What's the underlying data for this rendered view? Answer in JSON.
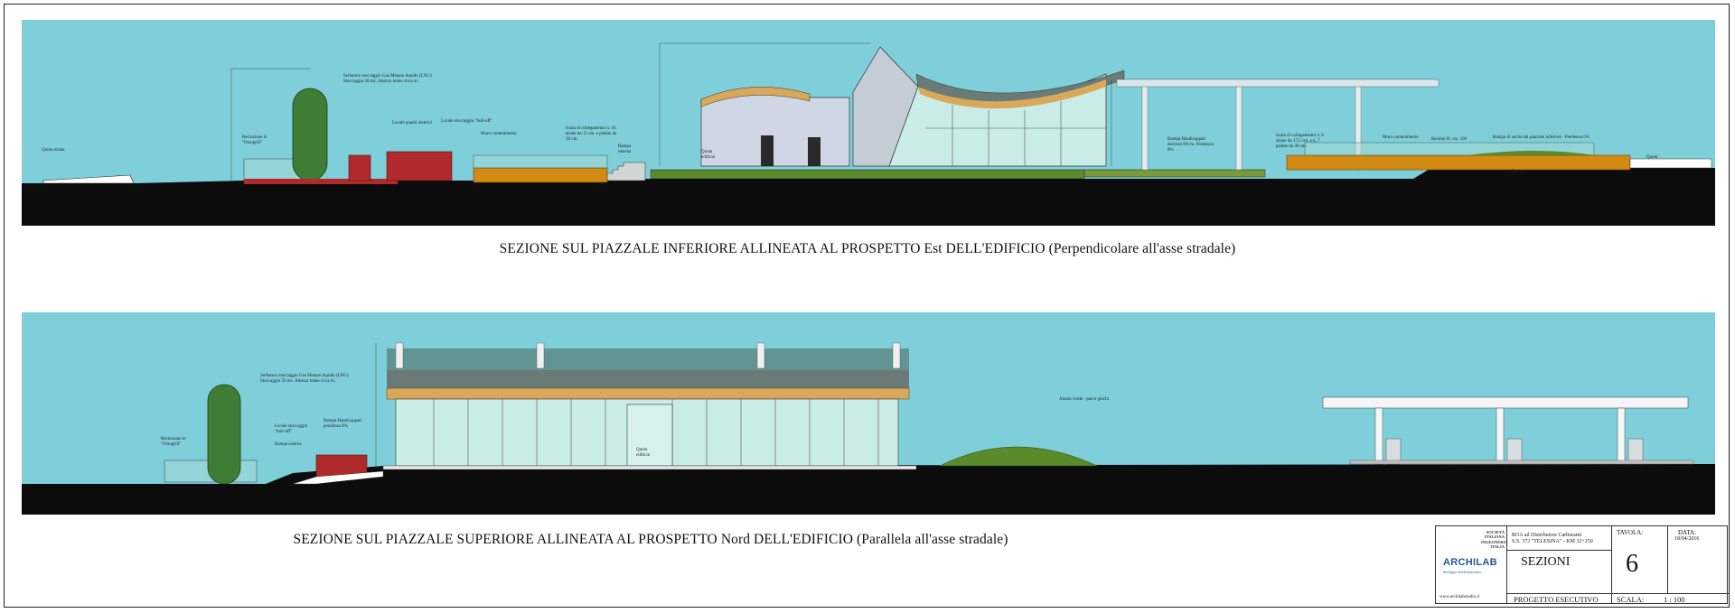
{
  "captions": {
    "top": "SEZIONE SUL PIAZZALE INFERIORE ALLINEATA AL PROSPETTO Est DELL'EDIFICIO (Perpendicolare all'asse stradale)",
    "bottom": "SEZIONE SUL PIAZZALE SUPERIORE ALLINEATA AL PROSPETTO Nord DELL'EDIFICIO (Parallela all'asse stradale)"
  },
  "top_notes": {
    "quota_left": "Quota strada",
    "recinzione": "Recinzione in \"Orsogrill\"",
    "serbatoio": "Serbatoio stoccaggio Gas Metano liquido (LNG) Stoccaggio 50 mc. Altezza totale circa m.",
    "locale_quadri": "Locale quadri elettrici",
    "locale_stoccaggio": "Locale stoccaggio \"boil-off\"",
    "muro": "Muro contenimento",
    "scala": "Scala di collegamento n. 10 alzate da 15 cm. e pedate da 30 cm.",
    "rampa_esterna": "Rampa esterna",
    "quota_bldg": "Quota edificio",
    "rampa_handicap": "Rampa Handicappati declivio 8% m. Pendenza 8%",
    "scala_2": "Scala di collegamento n. 8 alzate da 17,5 cm. e n. 7 pedate da 30 cm.",
    "muro_2": "Muro contenimento",
    "recinto": "Recinto H. cm. 100",
    "rampa_uscita": "Rampa di uscita dal piazzale inferiore - Pendenza 6%",
    "quota_right": "Quota",
    "quota_mid": "Quota"
  },
  "bottom_notes": {
    "recinzione": "Recinzione in \"Orsogrill\"",
    "serbatoio": "Serbatoio stoccaggio Gas Metano liquido (LNG) Stoccaggio 50 mc. Altezza totale circa m.",
    "locale_stoccaggio": "Locale stoccaggio \"boil-off\"",
    "rampa_esterna": "Rampa esterna",
    "rampa_handicap": "Rampa Handicappati pendenza 8%",
    "quota_edificio": "Quota edificio",
    "aiuola": "Aiuola verde - parco giochi"
  },
  "title_block": {
    "logo_top": "ARCHILAB",
    "logo_sub": "Sviluppo Architettonico",
    "logo_right_lines": [
      "SOCIETÀ ITALIANA",
      "INGEGNERIA",
      "ITALIA"
    ],
    "project_line1": "ROA ad Distributore Carburanti",
    "project_line2": "S.S. 372 \"TELESINA\" - KM 32+250",
    "drawing_title": "SEZIONI",
    "phase": "PROGETTO  ESECUTIVO",
    "website": "www.archilabstudio.it",
    "tavola_label": "TAVOLA:",
    "tavola_value": "6",
    "data_label": "DATA:",
    "data_value": "18/04/2016",
    "scala_label": "SCALA:",
    "scala_value": "1 : 100"
  },
  "colors": {
    "sky": "#7ecfd9",
    "ground": "#0c0c0c",
    "tank": "#3f7d34",
    "red_block": "#b02a2a",
    "orange_wall": "#d28a12",
    "wood_band": "#d9a85a",
    "glass": "#c9ece6",
    "grass": "#5a8a2a",
    "roof_grey": "#6a7a76"
  }
}
